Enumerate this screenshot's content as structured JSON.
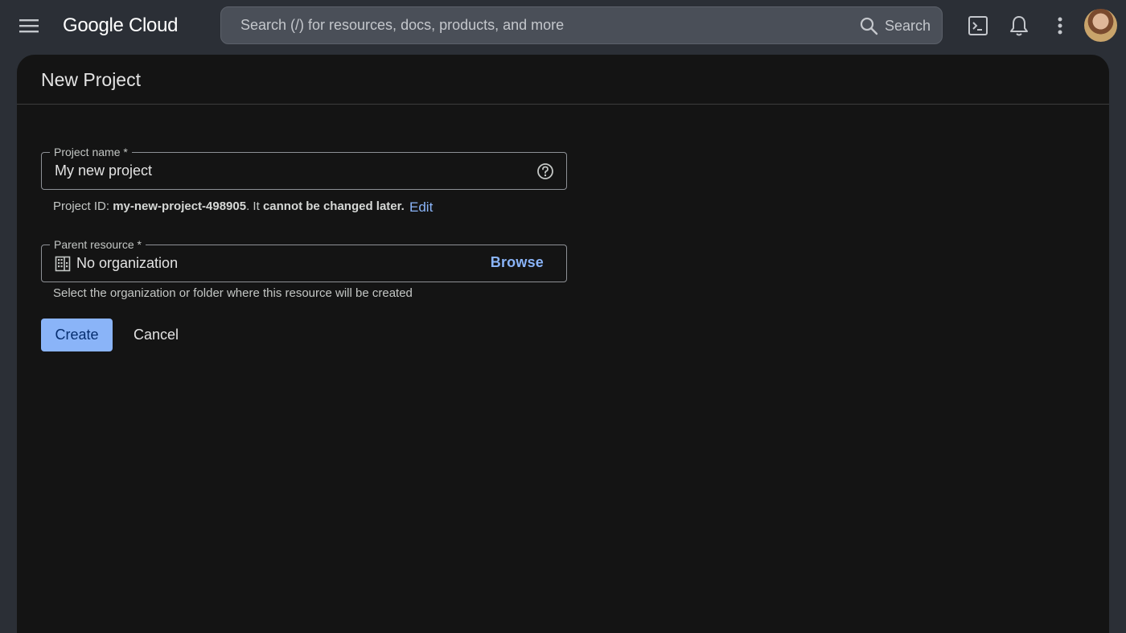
{
  "topbar": {
    "menu_icon": "hamburger-menu-icon",
    "logo_text": "Google Cloud",
    "search": {
      "placeholder": "Search (/) for resources, docs, products, and more",
      "button_label": "Search",
      "icon": "search-icon"
    },
    "icons": [
      "terminal-icon",
      "bell-icon",
      "more-vert-icon"
    ],
    "avatar": "user-avatar"
  },
  "page": {
    "title": "New Project"
  },
  "form": {
    "project_name": {
      "label": "Project name *",
      "value": "My new project",
      "help_icon": "help-circle-icon"
    },
    "project_id_hint": {
      "prefix": "Project ID: ",
      "project_id": "my-new-project-498905",
      "middle": ". It ",
      "emphasis": "cannot be changed later.",
      "edit_label": "Edit"
    },
    "parent_resource": {
      "label": "Parent resource *",
      "value": "No organization",
      "icon": "organization-building-icon",
      "browse_label": "Browse",
      "hint": "Select the organization or folder where this resource will be created"
    },
    "create_label": "Create",
    "cancel_label": "Cancel"
  },
  "colors": {
    "background": "#2b2f36",
    "panel": "#141414",
    "accent": "#8ab4f8",
    "text": "#e3e3e3"
  }
}
